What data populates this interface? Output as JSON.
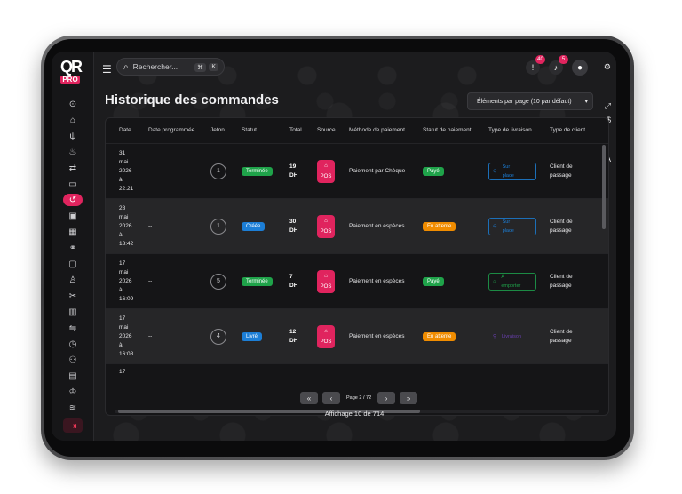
{
  "app": {
    "logo_text": "QR",
    "logo_badge": "PRO"
  },
  "search": {
    "placeholder": "Rechercher...",
    "shortcut_1": "⌘",
    "shortcut_2": "K"
  },
  "notifications": {
    "alerts_count": "40",
    "bell_count": "5"
  },
  "page": {
    "title": "Historique des commandes",
    "page_size_label": "Éléments par page (10 par défaut)"
  },
  "table": {
    "headers": {
      "date": "Date",
      "scheduled": "Date programmée",
      "token": "Jeton",
      "status": "Statut",
      "total": "Total",
      "source": "Source",
      "pay_method": "Méthode de paiement",
      "pay_status": "Statut de paiement",
      "delivery": "Type de livraison",
      "client": "Type de client"
    },
    "rows": [
      {
        "date_1": "31",
        "date_2": "mai",
        "date_3": "2026",
        "date_4": "à",
        "date_5": "22:21",
        "scheduled": "--",
        "token": "1",
        "status": "Terminée",
        "status_color": "green",
        "total_1": "19",
        "total_2": "DH",
        "source": "POS",
        "pay_method": "Paiement par Chèque",
        "pay_status": "Payé",
        "pay_color": "green",
        "delivery_1": "Sur",
        "delivery_2": "place",
        "delivery_style": "blue",
        "client_1": "Client de",
        "client_2": "passage"
      },
      {
        "date_1": "28",
        "date_2": "mai",
        "date_3": "2026",
        "date_4": "à",
        "date_5": "18:42",
        "scheduled": "--",
        "token": "1",
        "status": "Créée",
        "status_color": "blue",
        "total_1": "30",
        "total_2": "DH",
        "source": "POS",
        "pay_method": "Paiement en espèces",
        "pay_status": "En attente",
        "pay_color": "orange",
        "delivery_1": "Sur",
        "delivery_2": "place",
        "delivery_style": "blue",
        "client_1": "Client de",
        "client_2": "passage"
      },
      {
        "date_1": "17",
        "date_2": "mai",
        "date_3": "2026",
        "date_4": "à",
        "date_5": "16:09",
        "scheduled": "--",
        "token": "5",
        "status": "Terminée",
        "status_color": "green",
        "total_1": "7",
        "total_2": "DH",
        "source": "POS",
        "pay_method": "Paiement en espèces",
        "pay_status": "Payé",
        "pay_color": "green",
        "delivery_1": "À",
        "delivery_2": "emporter",
        "delivery_style": "green",
        "client_1": "Client de",
        "client_2": "passage"
      },
      {
        "date_1": "17",
        "date_2": "mai",
        "date_3": "2026",
        "date_4": "à",
        "date_5": "16:08",
        "scheduled": "--",
        "token": "4",
        "status": "Livré",
        "status_color": "blue",
        "total_1": "12",
        "total_2": "DH",
        "source": "POS",
        "pay_method": "Paiement en espèces",
        "pay_status": "En attente",
        "pay_color": "orange",
        "delivery_1": "Livraison",
        "delivery_2": "",
        "delivery_style": "purple",
        "client_1": "Client de",
        "client_2": "passage"
      }
    ],
    "partial_row_date": "17"
  },
  "pagination": {
    "first": "«",
    "prev": "‹",
    "page_info": "Page 2 / 72",
    "next": "›",
    "last": "»",
    "showing": "Affichage 10 de 714"
  },
  "colors": {
    "accent": "#e0245e",
    "green": "#1fa34a",
    "blue": "#1c7ed6",
    "orange": "#f08c00"
  }
}
